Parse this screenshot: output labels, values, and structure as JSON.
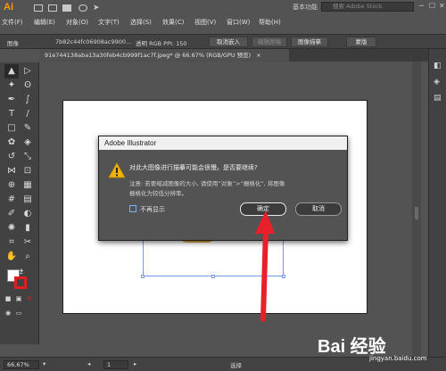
{
  "app": {
    "logo": "Ai",
    "workspace": "基本功能",
    "search_placeholder": "搜索 Adobe Stock",
    "win_min": "─",
    "win_max": "☐",
    "win_close": "✕"
  },
  "menu": [
    "文件(F)",
    "编辑(E)",
    "对象(O)",
    "文字(T)",
    "选择(S)",
    "效果(C)",
    "视图(V)",
    "窗口(W)",
    "帮助(H)"
  ],
  "control_bar": {
    "type_label": "图像",
    "filename": "7b82c44fc06908ac9900...",
    "info": "透明 RGB PPI: 150",
    "embed": "取消嵌入",
    "edit_original": "编辑原稿",
    "trace": "图像描摹",
    "mask": "蒙版"
  },
  "doc_tab": {
    "label": "91e744138aba13a30feb4cb999f1ac7f.jpeg* @ 66.67% (RGB/GPU 预览)",
    "close": "×"
  },
  "dialog": {
    "title": "Adobe Illustrator",
    "message": "对此大图像进行描摹可能会很慢。是否要继续?",
    "note_line1": "注意: 若要缩减图像的大小, 请使用“对象”>“栅格化”, 将图像",
    "note_line2": "栅格化为较低分辨率。",
    "checkbox_label": "不再显示",
    "ok_label": "确定",
    "cancel_label": "取消"
  },
  "status": {
    "zoom": "66.67%",
    "page": "1",
    "mode": "选择"
  },
  "watermark": {
    "brand": "Bai 经验",
    "url": "jingyan.baidu.com"
  },
  "colors": {
    "accent_arrow": "#e8202a",
    "warning": "#f0b400"
  }
}
